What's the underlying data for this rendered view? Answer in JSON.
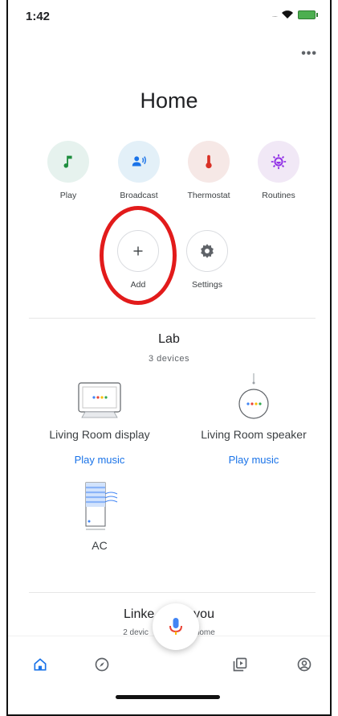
{
  "status_bar": {
    "time": "1:42",
    "signal": "....."
  },
  "header": {
    "title": "Home",
    "more_label": "•••"
  },
  "actions": [
    {
      "label": "Play",
      "icon": "music-note-icon",
      "bg": "#e6f2ee",
      "color": "#1e8e3e"
    },
    {
      "label": "Broadcast",
      "icon": "broadcast-icon",
      "bg": "#e3f0f8",
      "color": "#1a73e8"
    },
    {
      "label": "Thermostat",
      "icon": "thermometer-icon",
      "bg": "#f6e8e6",
      "color": "#d93025"
    },
    {
      "label": "Routines",
      "icon": "routines-icon",
      "bg": "#f1e8f6",
      "color": "#9334e6"
    },
    {
      "label": "Add",
      "icon": "plus-icon"
    },
    {
      "label": "Settings",
      "icon": "gear-icon"
    }
  ],
  "room": {
    "name": "Lab",
    "count": "3 devices",
    "devices": [
      {
        "name": "Living Room display",
        "action": "Play music",
        "icon": "smart-display-icon"
      },
      {
        "name": "Living Room speaker",
        "action": "Play music",
        "icon": "smart-speaker-icon"
      },
      {
        "name": "AC",
        "icon": "air-conditioner-icon"
      }
    ]
  },
  "linked": {
    "title": "Linke",
    "title_end": "you",
    "sub_start": "2 devic",
    "sub_end": "a home"
  },
  "bottom_nav": [
    "home-icon",
    "explore-icon",
    "media-icon",
    "account-icon"
  ],
  "colors": {
    "accent": "#1a73e8",
    "annotation": "#e21b1b"
  }
}
